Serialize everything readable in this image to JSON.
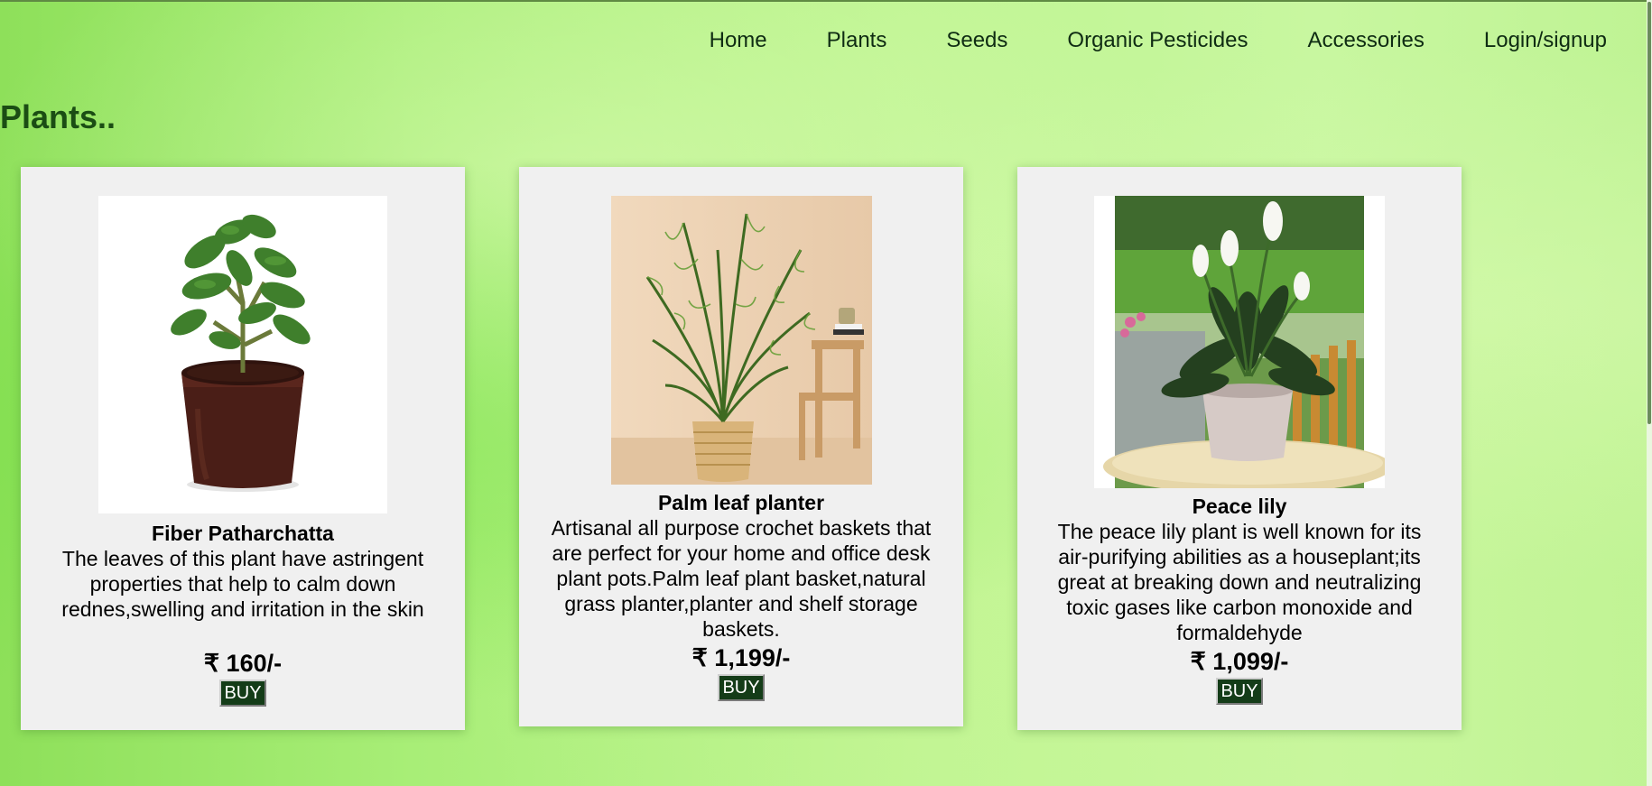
{
  "nav": {
    "items": [
      "Home",
      "Plants",
      "Seeds",
      "Organic Pesticides",
      "Accessories",
      "Login/signup"
    ]
  },
  "page": {
    "title": "Plants.."
  },
  "products": [
    {
      "name": "Fiber Patharchatta",
      "description": "The leaves of this plant have astringent properties that help to calm down rednes,swelling and irritation in the skin",
      "price": "₹ 160/-",
      "buy_label": "BUY"
    },
    {
      "name": "Palm leaf planter",
      "description": "Artisanal all purpose crochet baskets that are perfect for your home and office desk plant pots.Palm leaf plant basket,natural grass planter,planter and shelf storage baskets.",
      "price": "₹ 1,199/-",
      "buy_label": "BUY"
    },
    {
      "name": "Peace lily",
      "description": "The peace lily plant is well known for its air-purifying abilities as a houseplant;its great at breaking down and neutralizing toxic gases like carbon monoxide and formaldehyde",
      "price": "₹ 1,099/-",
      "buy_label": "BUY"
    }
  ],
  "colors": {
    "nav_text": "#0f2c13",
    "title_text": "#1b4d14",
    "card_bg": "#f0f0f0",
    "button_bg": "#143c18"
  }
}
